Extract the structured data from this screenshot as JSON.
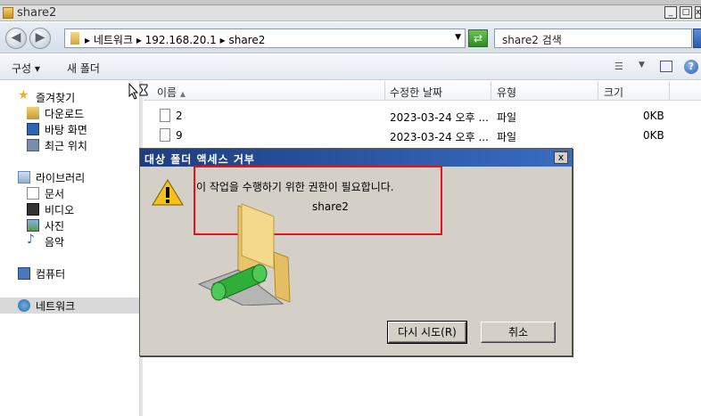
{
  "window": {
    "title": "share2",
    "buttons": {
      "minimize": "_",
      "maximize": "□",
      "close": "x"
    }
  },
  "address": {
    "breadcrumbs": "▸ 네트워크 ▸ 192.168.20.1 ▸ share2",
    "search_placeholder": "share2 검색"
  },
  "toolbar": {
    "organize_label": "구성 ▾",
    "new_folder_label": "새 폴더",
    "help_label": "?"
  },
  "nav": {
    "favorites": {
      "label": "즐겨찾기",
      "items": [
        "다운로드",
        "바탕 화면",
        "최근 위치"
      ]
    },
    "libraries": {
      "label": "라이브러리",
      "items": [
        "문서",
        "비디오",
        "사진",
        "음악"
      ]
    },
    "computer": "컴퓨터",
    "network": "네트워크"
  },
  "columns": {
    "name": "이름",
    "modified": "수정한 날짜",
    "type": "유형",
    "size": "크기"
  },
  "files": [
    {
      "name": "2",
      "modified": "2023-03-24 오후 ...",
      "type": "파일",
      "size": "0KB"
    },
    {
      "name": "9",
      "modified": "2023-03-24 오후 ...",
      "type": "파일",
      "size": "0KB"
    }
  ],
  "dialog": {
    "title": "대상 폴더 액세스 거부",
    "close": "x",
    "message": "이 작업을 수행하기 위한 권한이 필요합니다.",
    "target": "share2",
    "retry_button": "다시 시도(R)",
    "cancel_button": "취소"
  },
  "colors": {
    "dialog_title_start": "#1c3d82",
    "dialog_title_end": "#3a6cc0",
    "highlight_border": "#e8111a",
    "dialog_bg": "#d4d0c8"
  }
}
